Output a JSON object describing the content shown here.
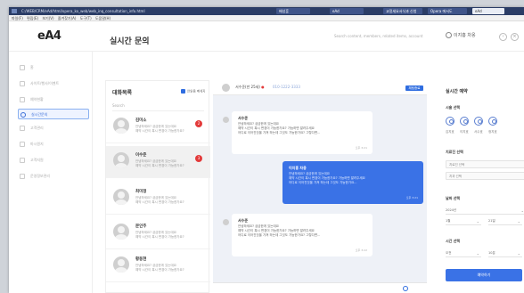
{
  "browser": {
    "title": "C:/WEB/CRM/eAd/html/opera_ko_web/web_inq_consultation_info.html",
    "tabs": [
      "배성훈",
      "eAd",
      "교정세요서식과 신청",
      "Opera 에서도",
      "eAd"
    ],
    "menu": [
      "파일(F)",
      "편집(E)",
      "보기(V)",
      "즐겨찾기(A)",
      "도구(T)",
      "도움말(H)"
    ]
  },
  "app": {
    "logo": "eA4",
    "search_placeholder": "Search content, members, related items, account",
    "user_label": "이지흥 차옹",
    "page_title": "실시간 문의"
  },
  "sidebar": {
    "items": [
      {
        "label": "홈"
      },
      {
        "label": "사이트/행사/이벤트"
      },
      {
        "label": "예약현황"
      },
      {
        "label": "실시간문의"
      },
      {
        "label": "고객관리"
      },
      {
        "label": "마시원지"
      },
      {
        "label": "고객지원"
      },
      {
        "label": "운영정보관리"
      }
    ]
  },
  "list": {
    "title": "대화목록",
    "toggle_label": "안읽음 메세지",
    "search_placeholder": "Search",
    "items": [
      {
        "name": "김미소",
        "line1": "안녕하세요? 궁금한게 있는데요",
        "line2": "예약 시간이 혹시 변경이 가능한가요?",
        "badge": "2"
      },
      {
        "name": "이수준",
        "line1": "안녕하세요? 궁금한게 있는데요",
        "line2": "예약 시간이 혹시 변경이 가능한가요?",
        "badge": "3"
      },
      {
        "name": "최미정",
        "line1": "안녕하세요? 궁금한게 있는데요",
        "line2": "예약 시간이 혹시 변경이 가능한가요?",
        "badge": ""
      },
      {
        "name": "문인주",
        "line1": "안녕하세요? 궁금한게 있는데요",
        "line2": "예약 시간이 혹시 변경이 가능한가요?",
        "badge": ""
      },
      {
        "name": "황동현",
        "line1": "안녕하세요? 궁금한게 있는데요",
        "line2": "예약 시간이 혹시 변경이 가능한가요?",
        "badge": ""
      }
    ]
  },
  "chat": {
    "header_name": "서수준(만 25세)",
    "header_phone": "010-1222-3333",
    "end_button": "채팅종료",
    "messages": [
      {
        "sender": "서수준",
        "lines": [
          "안녕하세요? 궁금한게 있는데요",
          "예약 시간이 혹시 변경이 가능한가요? 가능하면 알려주세요",
          "어디로 이어진것을 가져 하는데 그것도 가능한가요? 그렇다면..."
        ],
        "time": "오후 3:21"
      },
      {
        "sender": "이지흥 차옹",
        "lines": [
          "안녕하세요? 궁금한게 있는데요",
          "예약 시간이 혹시 변경이 가능한가요? 가능하면 알려주세요",
          "어디로 이어진것을 가져 하는데 그것도 가능한가요..."
        ],
        "time": "오후 3:21"
      },
      {
        "sender": "서수준",
        "lines": [
          "안녕하세요? 궁금한게 있는데요",
          "예약 시간이 혹시 변경이 가능한가요? 가능하면 알려주세요",
          "어디로 이어진것을 가져 하는데 그것도 가능한가요? 그렇다면..."
        ],
        "time": "오후 3:22"
      }
    ]
  },
  "reserve": {
    "title": "실시간 예약",
    "staff_label": "시술 선택",
    "staff": [
      "김지호",
      "이지호",
      "서수호",
      "정지호"
    ],
    "treatment_label": "치료진 선택",
    "treatment_fields": [
      "치료진 선택",
      "치과 선택"
    ],
    "date_label": "날짜 선택",
    "date_fields": [
      "2024년",
      "1월",
      "21일"
    ],
    "time_label": "시간 선택",
    "time_fields": [
      "오전",
      "10분"
    ],
    "submit": "예약하기"
  },
  "colors": {
    "accent": "#3a72e6",
    "badge": "#e33b3b",
    "chat_bg": "#eef1f7"
  }
}
